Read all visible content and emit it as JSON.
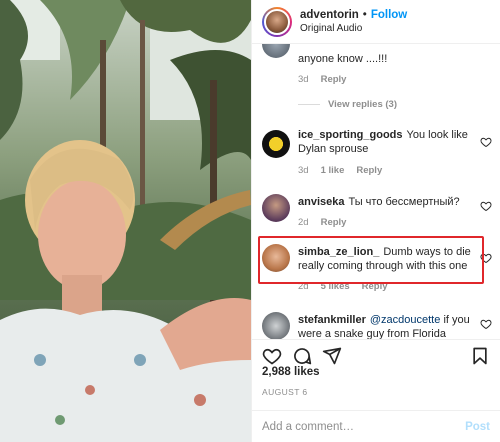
{
  "header": {
    "username": "adventorin",
    "separator": "•",
    "follow_label": "Follow",
    "audio": "Original Audio"
  },
  "comments": [
    {
      "text": "anyone know ....!!!",
      "time": "3d",
      "reply": "Reply",
      "view_replies": "View replies (3)"
    },
    {
      "user": "ice_sporting_goods",
      "text": "You look like Dylan sprouse",
      "time": "3d",
      "likes": "1 like",
      "reply": "Reply"
    },
    {
      "user": "anviseka",
      "text": "Ты что бессмертный?",
      "time": "2d",
      "reply": "Reply"
    },
    {
      "user": "simba_ze_lion_",
      "text": "Dumb ways to die really coming through with this one",
      "time": "2d",
      "likes": "5 likes",
      "reply": "Reply"
    },
    {
      "user": "stefankmiller",
      "mention": "@zacdoucette",
      "text": "if you were a snake guy from Florida"
    }
  ],
  "post": {
    "likes": "2,988 likes",
    "date": "AUGUST 6"
  },
  "add_comment": {
    "placeholder": "Add a comment…",
    "post_label": "Post"
  },
  "icons": {
    "like": "heart-icon",
    "comment": "comment-icon",
    "share": "paper-plane-icon",
    "save": "bookmark-icon"
  },
  "colors": {
    "follow": "#0095f6",
    "highlight": "#e0272b",
    "post_disabled": "#b2dffc"
  }
}
